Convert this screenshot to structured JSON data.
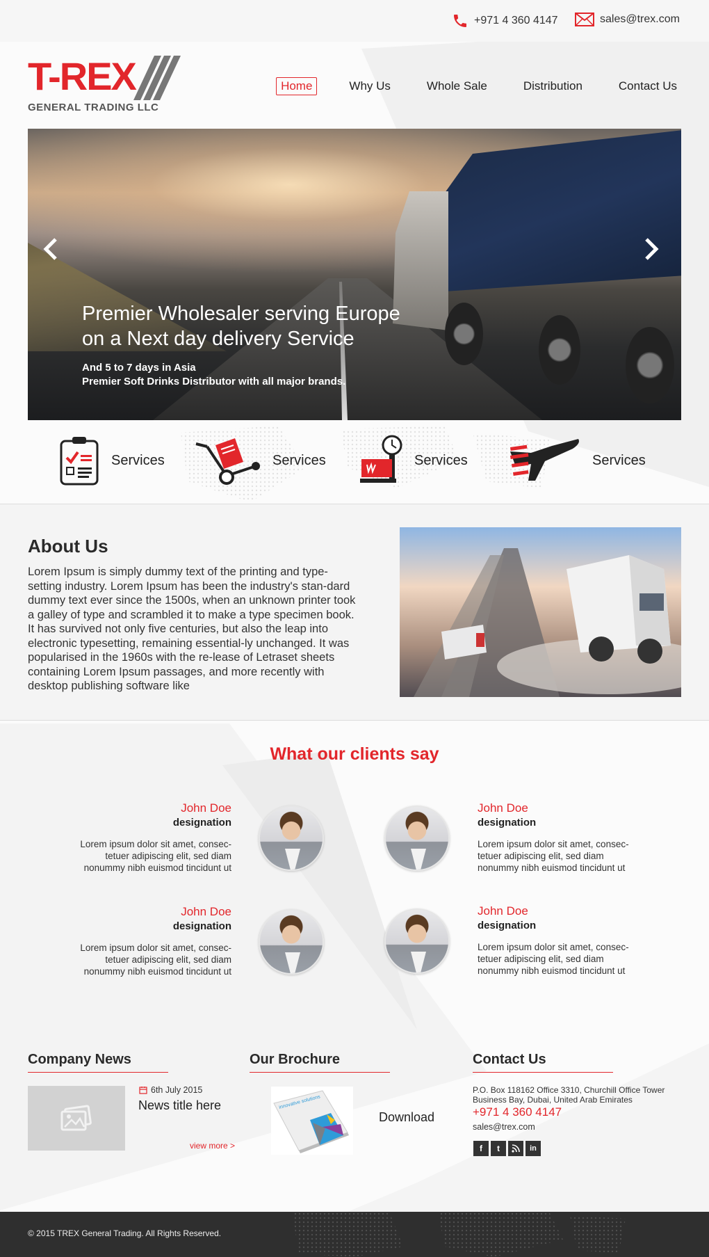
{
  "topbar": {
    "phone": "+971 4 360 4147",
    "email": "sales@trex.com"
  },
  "logo": {
    "name": "T-REX",
    "tagline": "GENERAL TRADING LLC"
  },
  "nav": [
    {
      "label": "Home",
      "active": true
    },
    {
      "label": "Why Us",
      "active": false
    },
    {
      "label": "Whole Sale",
      "active": false
    },
    {
      "label": "Distribution",
      "active": false
    },
    {
      "label": "Contact Us",
      "active": false
    }
  ],
  "hero": {
    "title_line1": "Premier Wholesaler serving Europe",
    "title_line2": "on a Next day delivery Service",
    "sub_line1": "And 5 to 7 days in Asia",
    "sub_line2": "Premier Soft Drinks Distributor with all major brands.",
    "prev_icon": "chevron-left-icon",
    "next_icon": "chevron-right-icon"
  },
  "services": [
    {
      "label": "Services",
      "icon": "clipboard-icon"
    },
    {
      "label": "Services",
      "icon": "hand-truck-icon"
    },
    {
      "label": "Services",
      "icon": "scale-icon"
    },
    {
      "label": "Services",
      "icon": "airplane-icon"
    }
  ],
  "about": {
    "title": "About Us",
    "text": "Lorem Ipsum is simply dummy text of the printing and type-setting industry. Lorem Ipsum has been the industry's stan-dard dummy text ever since the 1500s, when an unknown printer took a galley of type and scrambled it to make a type specimen book. It has survived not only five centuries, but also the leap into electronic typesetting, remaining essential-ly unchanged. It was popularised in the 1960s with the re-lease of Letraset sheets containing Lorem Ipsum passages, and more recently with desktop publishing software like"
  },
  "testimonials": {
    "title": "What our clients say",
    "items": [
      {
        "name": "John Doe",
        "designation": "designation",
        "text": "Lorem ipsum dolor sit amet, consec-tetuer adipiscing elit, sed diam nonummy nibh euismod tincidunt ut"
      },
      {
        "name": "John Doe",
        "designation": "designation",
        "text": "Lorem ipsum dolor sit amet, consec-tetuer adipiscing elit, sed diam nonummy nibh euismod tincidunt ut"
      },
      {
        "name": "John Doe",
        "designation": "designation",
        "text": "Lorem ipsum dolor sit amet, consec-tetuer adipiscing elit, sed diam nonummy nibh euismod tincidunt ut"
      },
      {
        "name": "John Doe",
        "designation": "designation",
        "text": "Lorem ipsum dolor sit amet, consec-tetuer adipiscing elit, sed diam nonummy nibh euismod tincidunt ut"
      }
    ]
  },
  "news": {
    "title": "Company News",
    "date": "6th July 2015",
    "item_title": "News title here",
    "view_more": "view more >"
  },
  "brochure": {
    "title": "Our Brochure",
    "cover_text": "innovative solutions",
    "download": "Download"
  },
  "contact": {
    "title": "Contact Us",
    "address_line1": "P.O. Box 118162 Office 3310, Churchill Office Tower",
    "address_line2": "Business Bay, Dubai, United Arab Emirates",
    "phone": "+971 4 360 4147",
    "email": "sales@trex.com",
    "socials": [
      {
        "icon": "facebook-icon",
        "glyph": "f"
      },
      {
        "icon": "twitter-icon",
        "glyph": "t"
      },
      {
        "icon": "rss-icon",
        "glyph": "⁂"
      },
      {
        "icon": "linkedin-icon",
        "glyph": "in"
      }
    ]
  },
  "footer": {
    "copyright": "©  2015 TREX General Trading. All Rights Reserved."
  },
  "colors": {
    "brand_red": "#e2262b",
    "dark": "#2f2f2f"
  }
}
